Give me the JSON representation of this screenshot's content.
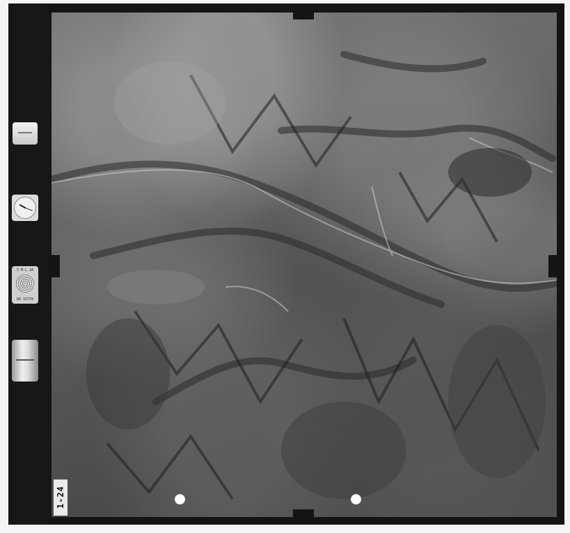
{
  "photo": {
    "frame_label": "1-24",
    "altimeter_text_top": "I M L 2A",
    "altimeter_text_bottom": "80 15770",
    "subject": "aerial-photograph"
  },
  "colors": {
    "frame": "#141414",
    "paper": "#f4f4f4"
  }
}
